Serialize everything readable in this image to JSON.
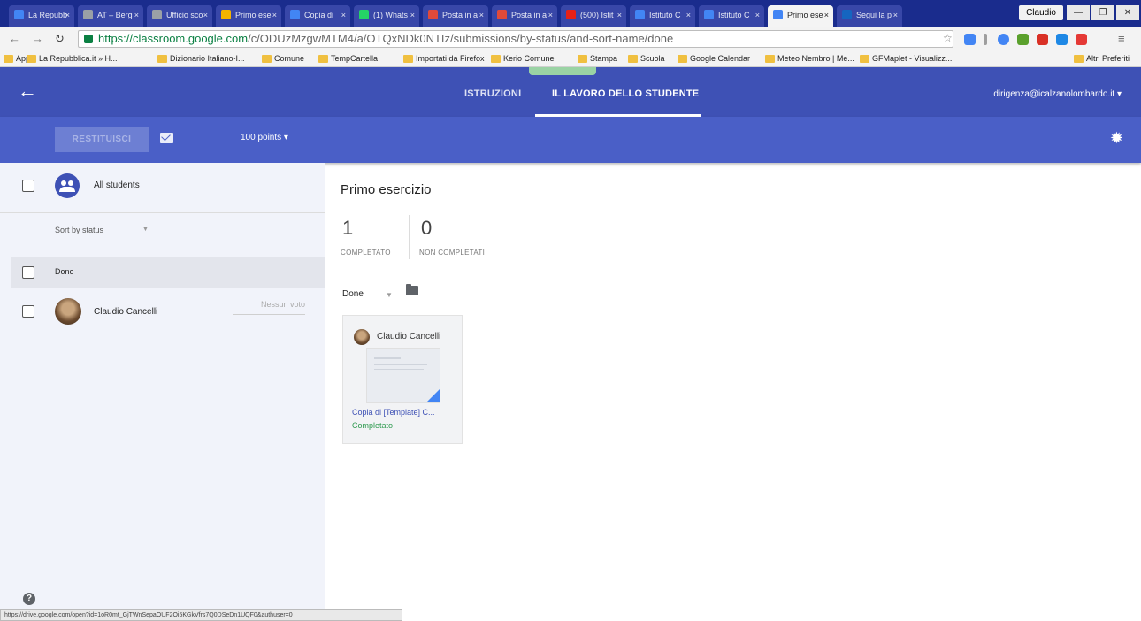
{
  "browser": {
    "tabs": [
      {
        "label": "La Repubb",
        "color": "#4285f4"
      },
      {
        "label": "AT – Berg",
        "color": "#9aa0a6"
      },
      {
        "label": "Ufficio sco",
        "color": "#9aa0a6"
      },
      {
        "label": "Primo ese",
        "color": "#f4b400"
      },
      {
        "label": "Copia di",
        "color": "#4285f4"
      },
      {
        "label": "(1) Whats",
        "color": "#25d366"
      },
      {
        "label": "Posta in a",
        "color": "#e04a3a"
      },
      {
        "label": "Posta in a",
        "color": "#e04a3a"
      },
      {
        "label": "(500) Istit",
        "color": "#e62117"
      },
      {
        "label": "Istituto C",
        "color": "#4285f4"
      },
      {
        "label": "Istituto C",
        "color": "#4285f4"
      },
      {
        "label": "Primo ese",
        "color": "#4285f4"
      },
      {
        "label": "Segui la p",
        "color": "#1565c0"
      }
    ],
    "user": "Claudio",
    "url_host": "https://classroom.google.com",
    "url_path": "/c/ODUzMzgwMTM4/a/OTQxNDk0NTIz/submissions/by-status/and-sort-name/done",
    "bookmarks": [
      "App",
      "La Repubblica.it » H...",
      "Dizionario Italiano-I...",
      "Comune",
      "TempCartella",
      "Importati da Firefox",
      "Kerio Comune",
      "Stampa",
      "Scuola",
      "Google Calendar",
      "Meteo Nembro | Me...",
      "GFMaplet - Visualizz...",
      "Altri Preferiti"
    ],
    "status_url": "https://drive.google.com/open?id=1oR0mt_GjTWnSepaOUF2Oi5KGkVfrs7Q0DSeDn1UQF0&authuser=0"
  },
  "header": {
    "tab_instructions": "ISTRUZIONI",
    "tab_student_work": "IL LAVORO DELLO STUDENTE",
    "account": "dirigenza@icalzanolombardo.it ▾"
  },
  "toolbar": {
    "return_label": "RESTITUISCI",
    "points": "100 points ▾"
  },
  "left_panel": {
    "all_students": "All students",
    "sort_label": "Sort by status",
    "group_label": "Done",
    "student_name": "Claudio Cancelli",
    "grade_placeholder": "Nessun voto"
  },
  "assignment": {
    "title": "Primo esercizio",
    "done_count": "1",
    "done_label": "COMPLETATO",
    "not_done_count": "0",
    "not_done_label": "NON COMPLETATI",
    "filter": "Done"
  },
  "submission_card": {
    "student": "Claudio Cancelli",
    "file": "Copia di [Template] C...",
    "status": "Completato"
  },
  "colors": {
    "header": "#3e51b5",
    "toolbar": "#4a5fc7",
    "completed": "#2e9a4f"
  }
}
